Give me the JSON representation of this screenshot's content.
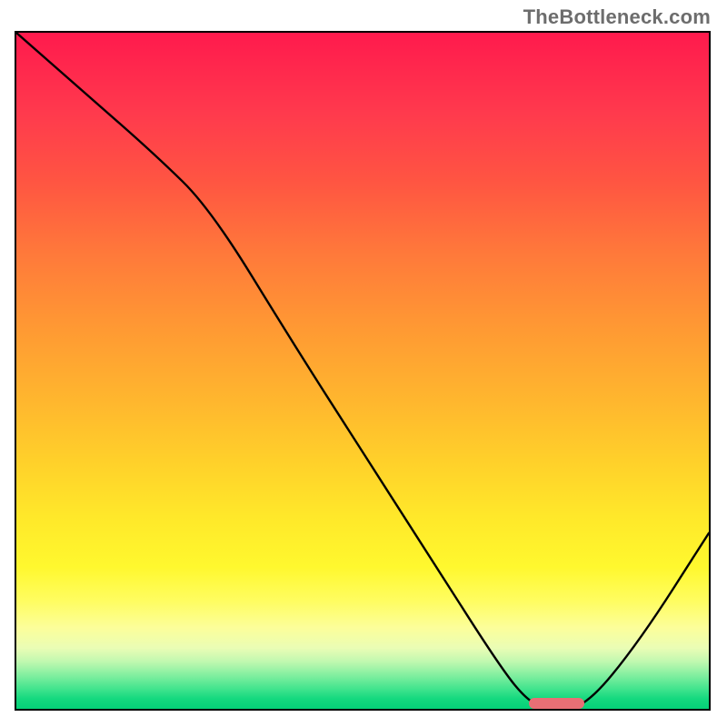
{
  "watermark": "TheBottleneck.com",
  "chart_data": {
    "type": "line",
    "title": "",
    "xlabel": "",
    "ylabel": "",
    "xlim": [
      0,
      100
    ],
    "ylim": [
      0,
      100
    ],
    "grid": false,
    "legend": false,
    "series": [
      {
        "name": "bottleneck-curve",
        "x": [
          0,
          10,
          20,
          28,
          40,
          50,
          60,
          70,
          74,
          77,
          82,
          90,
          100
        ],
        "values": [
          100,
          91,
          82,
          74,
          54,
          38,
          22,
          6,
          1,
          0,
          0,
          10,
          26
        ]
      }
    ],
    "annotations": [
      {
        "name": "optimal-range",
        "x_start": 74,
        "x_end": 82,
        "y": 0.8
      }
    ],
    "background_gradient_stops": [
      {
        "pct": 0,
        "color": "#ff1a4d"
      },
      {
        "pct": 50,
        "color": "#ffbb2e"
      },
      {
        "pct": 85,
        "color": "#fffd60"
      },
      {
        "pct": 100,
        "color": "#05d178"
      }
    ]
  }
}
